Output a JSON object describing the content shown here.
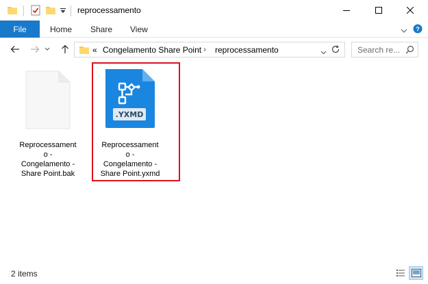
{
  "window": {
    "title": "reprocessamento"
  },
  "ribbon": {
    "tabs": [
      {
        "label": "File"
      },
      {
        "label": "Home"
      },
      {
        "label": "Share"
      },
      {
        "label": "View"
      }
    ]
  },
  "address": {
    "overflow": "«",
    "crumbs": [
      "Congelamento Share Point",
      "reprocessamento"
    ]
  },
  "search": {
    "placeholder": "Search re..."
  },
  "files": [
    {
      "name": "Reprocessamento - Congelamento - Share Point.bak",
      "label_lines": "Reprocessament\no -\nCongelamento -\nShare Point.bak",
      "icon": "generic-file-icon",
      "selected": false
    },
    {
      "name": "Reprocessamento - Congelamento - Share Point.yxmd",
      "label_lines": "Reprocessament\no -\nCongelamento -\nShare Point.yxmd",
      "icon": "yxmd-file-icon",
      "icon_badge": ".YXMD",
      "selected": true
    }
  ],
  "status": {
    "item_count": "2 items"
  },
  "colors": {
    "accent": "#1979ca",
    "highlight": "#d9121b",
    "yxmd_icon": "#1a86e0"
  }
}
